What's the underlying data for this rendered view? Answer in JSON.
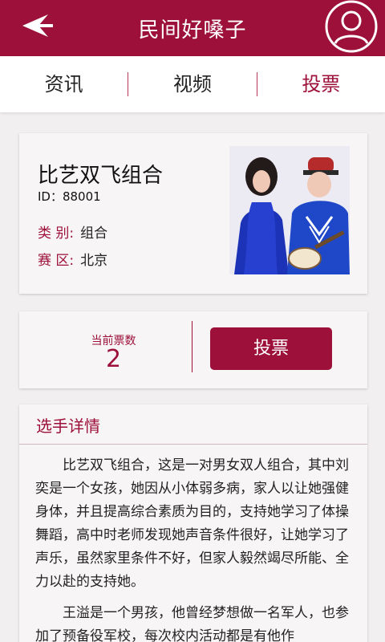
{
  "header": {
    "title": "民间好嗓子",
    "back_icon": "back-arrow-icon",
    "user_icon": "user-icon",
    "color": "#9c1039"
  },
  "tabs": [
    {
      "label": "资讯",
      "active": false
    },
    {
      "label": "视频",
      "active": false
    },
    {
      "label": "投票",
      "active": true
    }
  ],
  "contestant": {
    "name": "比艺双飞组合",
    "id_line": "ID：88001",
    "category_label": "类 别:",
    "category_value": "组合",
    "region_label": "赛 区:",
    "region_value": "北京"
  },
  "vote": {
    "label": "当前票数",
    "count": "2",
    "button_label": "投票"
  },
  "detail": {
    "heading": "选手详情",
    "paragraphs": [
      "比艺双飞组合，这是一对男女双人组合，其中刘奕是一个女孩，她因从小体弱多病，家人以让她强健身体，并且提高综合素质为目的，支持她学习了体操舞蹈，高中时老师发现她声音条件很好，让她学习了声乐，虽然家里条件不好，但家人毅然竭尽所能、全力以赴的支持她。",
      "王溢是一个男孩，他曾经梦想做一名军人，也参加了预备役军校，每次校内活动都是有他作"
    ]
  }
}
